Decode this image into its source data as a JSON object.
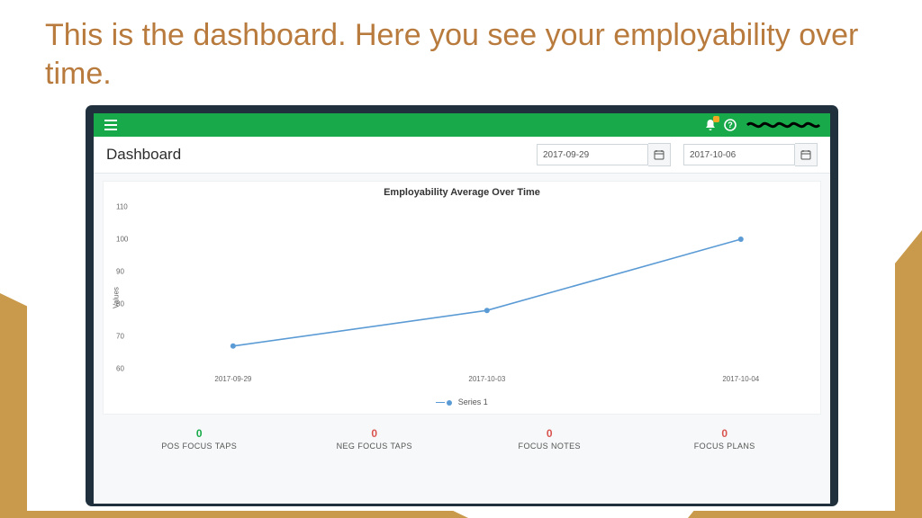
{
  "slide": {
    "headline": "This is the dashboard. Here you see your employability over time."
  },
  "topbar": {
    "menu_icon": "menu-icon",
    "bell_icon": "bell-icon",
    "help_icon": "help-icon"
  },
  "panel": {
    "title": "Dashboard",
    "date_from": "2017-09-29",
    "date_to": "2017-10-06"
  },
  "chart_data": {
    "type": "line",
    "title": "Employability Average Over Time",
    "xlabel": "",
    "ylabel": "Values",
    "ylim": [
      60,
      110
    ],
    "yticks": [
      60,
      70,
      80,
      90,
      100,
      110
    ],
    "categories": [
      "2017-09-29",
      "2017-10-03",
      "2017-10-04"
    ],
    "series": [
      {
        "name": "Series 1",
        "values": [
          67,
          78,
          100
        ],
        "color": "#5b9bd5"
      }
    ]
  },
  "counters": [
    {
      "value": "0",
      "label": "POS FOCUS TAPS",
      "style": "green"
    },
    {
      "value": "0",
      "label": "NEG FOCUS TAPS",
      "style": "red"
    },
    {
      "value": "0",
      "label": "FOCUS NOTES",
      "style": "red"
    },
    {
      "value": "0",
      "label": "FOCUS PLANS",
      "style": "red"
    }
  ]
}
